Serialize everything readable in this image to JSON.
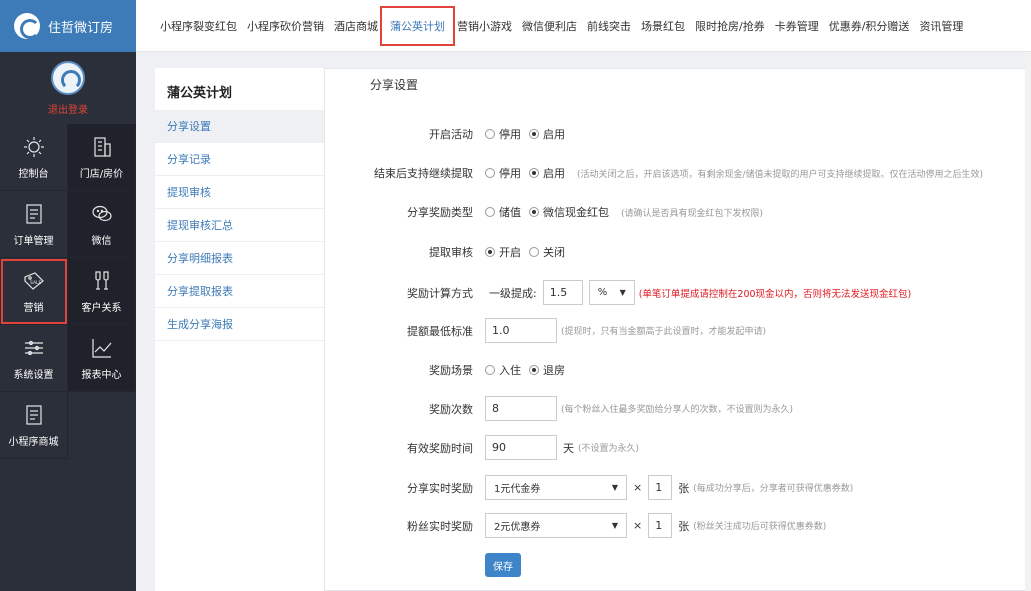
{
  "brand": {
    "name": "住哲微订房"
  },
  "user": {
    "logout_label": "退出登录"
  },
  "sidebar_nav": [
    {
      "label": "控制台",
      "icon": "sun-icon"
    },
    {
      "label": "门店/房价",
      "icon": "building-icon"
    },
    {
      "label": "订单管理",
      "icon": "document-icon"
    },
    {
      "label": "微信",
      "icon": "wechat-icon"
    },
    {
      "label": "营销",
      "icon": "sale-tag-icon"
    },
    {
      "label": "客户关系",
      "icon": "cheers-icon"
    },
    {
      "label": "系统设置",
      "icon": "sliders-icon"
    },
    {
      "label": "报表中心",
      "icon": "line-chart-icon"
    },
    {
      "label": "小程序商城",
      "icon": "document-icon"
    }
  ],
  "top_menu": [
    "小程序裂变红包",
    "小程序砍价营销",
    "酒店商城",
    "蒲公英计划",
    "营销小游戏",
    "微信便利店",
    "前线突击",
    "场景红包",
    "限时抢房/抢券",
    "卡券管理",
    "优惠券/积分赠送",
    "资讯管理"
  ],
  "subnav": {
    "title": "蒲公英计划",
    "items": [
      "分享设置",
      "分享记录",
      "提现审核",
      "提现审核汇总",
      "分享明细报表",
      "分享提取报表",
      "生成分享海报"
    ]
  },
  "section_title": "分享设置",
  "form": {
    "activity": {
      "label": "开启活动",
      "options": [
        "停用",
        "启用"
      ],
      "selected": "启用"
    },
    "continue_withdraw": {
      "label": "结束后支持继续提取",
      "options": [
        "停用",
        "启用"
      ],
      "selected": "启用",
      "hint": "(活动关闭之后，开启该选项，有剩余现金/储值未提取的用户可支持继续提取。仅在活动停用之后生效)"
    },
    "reward_type": {
      "label": "分享奖励类型",
      "options": [
        "储值",
        "微信现金红包"
      ],
      "selected": "微信现金红包",
      "hint": "(请确认是否具有现金红包下发权限)"
    },
    "withdraw_audit": {
      "label": "提取审核",
      "options": [
        "开启",
        "关闭"
      ],
      "selected": "开启"
    },
    "reward_calc": {
      "label": "奖励计算方式",
      "level_label": "一级提成:",
      "value": "1.5",
      "unit": "%",
      "hint": "(单笔订单提成请控制在200现金以内，否则将无法发送现金红包)"
    },
    "min_withdraw": {
      "label": "提额最低标准",
      "value": "1.0",
      "hint": "(提现时，只有当金额高于此设置时，才能发起申请)"
    },
    "reward_scene": {
      "label": "奖励场景",
      "options": [
        "入住",
        "退房"
      ],
      "selected": "退房"
    },
    "reward_count": {
      "label": "奖励次数",
      "value": "8",
      "hint": "(每个粉丝入住最多奖励给分享人的次数，不设置则为永久)"
    },
    "valid_time": {
      "label": "有效奖励时间",
      "value": "90",
      "unit": "天",
      "hint": "(不设置为永久)"
    },
    "share_reward": {
      "label": "分享实时奖励",
      "selected": "1元代金券",
      "times": "×",
      "qty": "1",
      "unit": "张",
      "hint": "(每成功分享后，分享者可获得优惠券数)"
    },
    "fan_reward": {
      "label": "粉丝实时奖励",
      "selected": "2元优惠券",
      "times": "×",
      "qty": "1",
      "unit": "张",
      "hint": "(粉丝关注成功后可获得优惠券数)"
    },
    "save_label": "保存"
  }
}
